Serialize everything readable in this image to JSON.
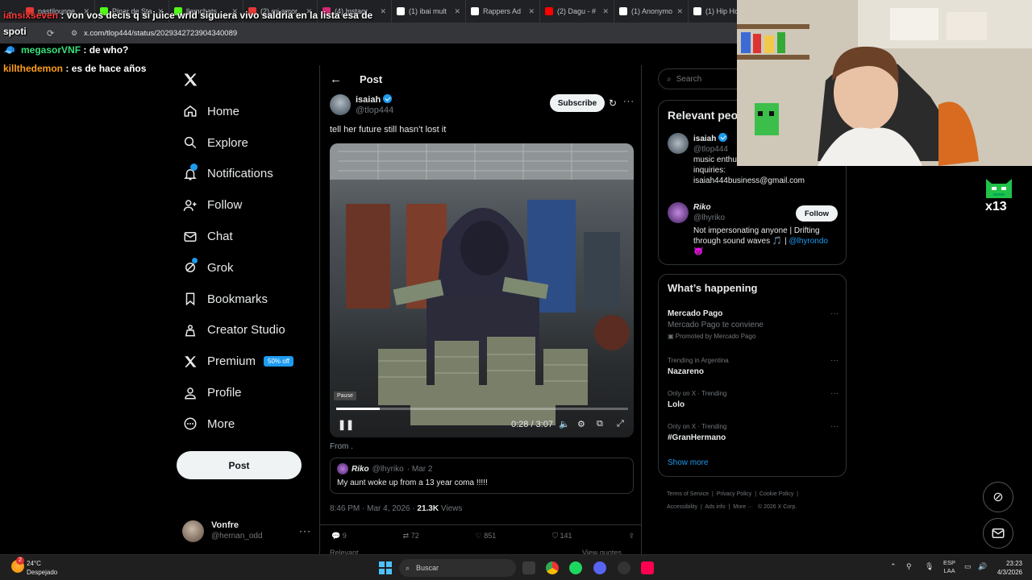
{
  "browser": {
    "tabs": [
      {
        "title": "pastilounge",
        "color": "#e53935"
      },
      {
        "title": "Pinar de Sta",
        "color": "#53fc18"
      },
      {
        "title": "llamchats",
        "color": "#53fc18"
      },
      {
        "title": "(2) mi amor",
        "color": "#e53935"
      },
      {
        "title": "(4) Instagr",
        "color": "#d62976"
      },
      {
        "title": "(1) ibai mult",
        "color": "#ffffff"
      },
      {
        "title": "Rappers Ad",
        "color": "#ffffff"
      },
      {
        "title": "(2) Dagu - #",
        "color": "#ff0000"
      },
      {
        "title": "(1) Anonymo",
        "color": "#ffffff"
      },
      {
        "title": "(1) Hip Ho",
        "color": "#ffffff"
      }
    ],
    "url": "x.com/tlop444/status/2029342723904340089"
  },
  "stream_chat": [
    {
      "user": "iansixseven",
      "message": "von vos decis q si juice wrld siguiera vivo saldria en la lista esa de",
      "color": "#ff3b3b"
    },
    {
      "user": "",
      "message": "spoti",
      "color": "#ffffff"
    },
    {
      "user": "megasorVNF",
      "message": "de who?",
      "color": "#36e07a"
    },
    {
      "user": "killthedemon",
      "message": "es de hace años",
      "color": "#ff9f1a"
    }
  ],
  "sidebar": {
    "items": [
      {
        "label": "Home",
        "icon": "home-icon"
      },
      {
        "label": "Explore",
        "icon": "search-icon"
      },
      {
        "label": "Notifications",
        "icon": "bell-icon"
      },
      {
        "label": "Follow",
        "icon": "person-add-icon"
      },
      {
        "label": "Chat",
        "icon": "mail-icon"
      },
      {
        "label": "Grok",
        "icon": "grok-icon"
      },
      {
        "label": "Bookmarks",
        "icon": "bookmark-icon"
      },
      {
        "label": "Creator Studio",
        "icon": "creator-icon"
      },
      {
        "label": "Premium",
        "icon": "x-logo-icon"
      },
      {
        "label": "Profile",
        "icon": "profile-icon"
      },
      {
        "label": "More",
        "icon": "more-icon"
      }
    ],
    "premium_badge": "50% off",
    "post_button": "Post",
    "account": {
      "name": "Vonfre",
      "handle": "@hernan_odd"
    }
  },
  "post": {
    "header": "Post",
    "author": "isaiah",
    "handle": "@tlop444",
    "subscribe": "Subscribe",
    "text": "tell her future still hasn’t lost it",
    "video": {
      "tooltip": "Pause",
      "time": "0:28 / 3:07",
      "progress": 0.15
    },
    "from": "From .",
    "quote": {
      "author": "Riko",
      "handle": "@lhyriko",
      "date": "· Mar 2",
      "text": "My aunt woke up from a 13 year coma !!!!!"
    },
    "meta": {
      "time": "8:46 PM · Mar 4, 2026 ·",
      "views": "21.3K",
      "views_label": "Views"
    },
    "stats": {
      "replies": "9",
      "reposts": "72",
      "likes": "851",
      "bookmarks": "141"
    },
    "relevant_tab": "Relevant",
    "view_quotes": "View quotes"
  },
  "right": {
    "search_placeholder": "Search",
    "relevant_title": "Relevant peo",
    "people": [
      {
        "name": "isaiah",
        "handle": "@tlop444",
        "bio_line1": "music enthu",
        "bio_line2": "inquiries:",
        "bio_line3": "isaiah444business@gmail.com"
      },
      {
        "name": "Riko",
        "handle": "@lhyriko",
        "follow": "Follow",
        "bio_line1": "Not impersonating anyone | Drifting",
        "bio_line2": "through sound waves 🎵 |",
        "bio_link": "@lhyrondo",
        "bio_line3": "😈"
      }
    ],
    "happening_title": "What’s happening",
    "trends": [
      {
        "context": "",
        "title": "Mercado Pago",
        "subtitle": "Mercado Pago te conviene",
        "promo": "Promoted by Mercado Pago"
      },
      {
        "context": "Trending in Argentina",
        "title": "Nazareno"
      },
      {
        "context": "Only on X · Trending",
        "title": "Lolo"
      },
      {
        "context": "Only on X · Trending",
        "title": "#GranHermano"
      }
    ],
    "show_more": "Show more",
    "footer": [
      "Terms of Service",
      "Privacy Policy",
      "Cookie Policy",
      "Accessibility",
      "Ads info",
      "More ···",
      "© 2026 X Corp."
    ]
  },
  "overlay_logo": "x13",
  "taskbar": {
    "weather_temp": "24°C",
    "weather_desc": "Despejado",
    "search": "Buscar",
    "lang": "ESP",
    "lang2": "LAA",
    "time": "23:23",
    "date": "4/3/2026",
    "weather_badge": "2"
  }
}
